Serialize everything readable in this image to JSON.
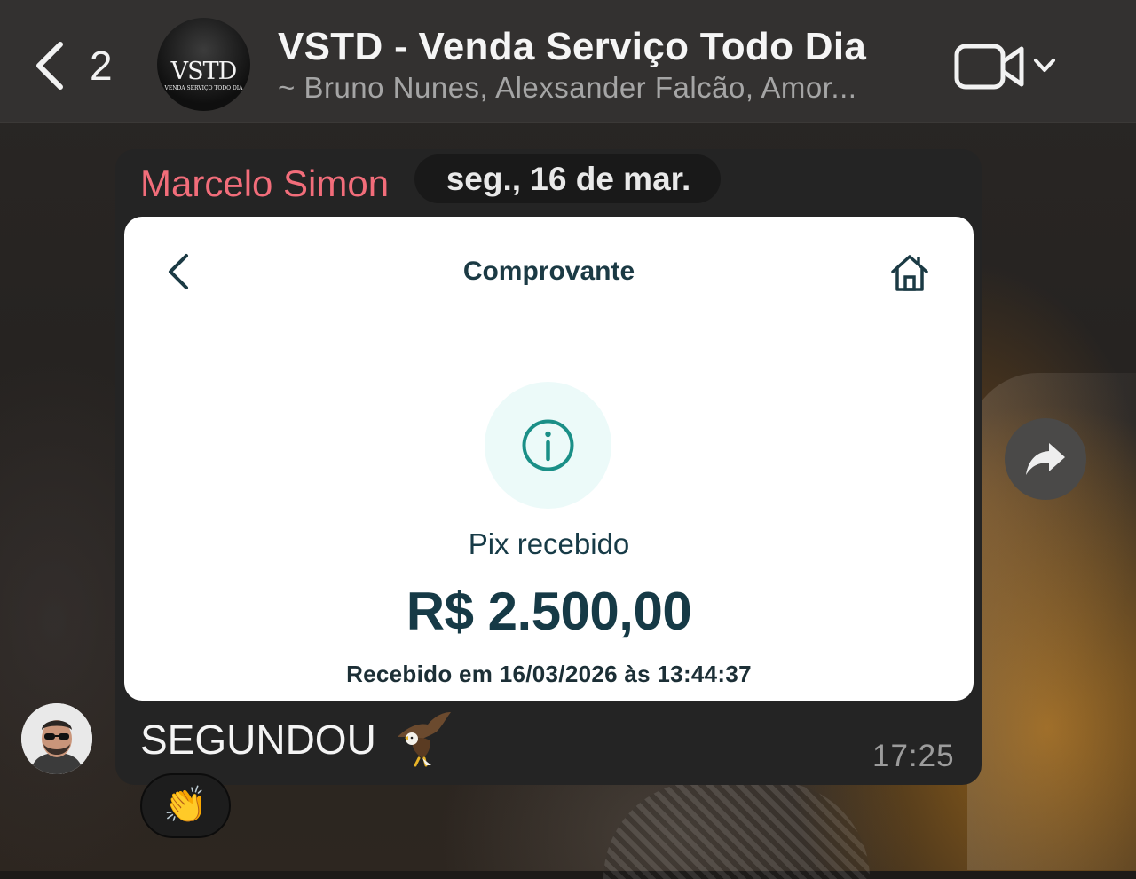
{
  "header": {
    "back_count": "2",
    "avatar_logo": "VSTD",
    "avatar_logo_sub": "VENDA SERVIÇO TODO DIA",
    "title": "VSTD - Venda Serviço Todo Dia",
    "members": "~ Bruno Nunes, Alexsander Falcão, Amor..."
  },
  "message": {
    "sender": "Marcelo Simon",
    "date_pill": "seg., 16 de mar.",
    "receipt": {
      "title": "Comprovante",
      "status": "Pix recebido",
      "amount": "R$ 2.500,00",
      "received_at": "Recebido em 16/03/2026 às 13:44:37"
    },
    "text": "SEGUNDOU",
    "text_emoji": "eagle",
    "time": "17:25",
    "reaction": "👏"
  },
  "colors": {
    "header_bg": "#333130",
    "bubble_bg": "#242424",
    "sender_name": "#f26d7a",
    "receipt_accent": "#1a8f87"
  },
  "icons": [
    "back-chevron-icon",
    "video-call-icon",
    "chevron-down-icon",
    "receipt-back-icon",
    "home-icon",
    "info-icon",
    "forward-icon",
    "eagle-emoji"
  ]
}
